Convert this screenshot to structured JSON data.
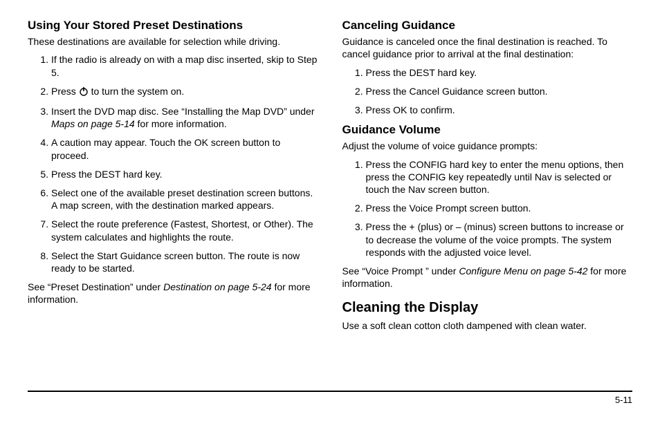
{
  "left": {
    "h1": "Using Your Stored Preset Destinations",
    "intro": "These destinations are available for selection while driving.",
    "steps": {
      "s1": "If the radio is already on with a map disc inserted, skip to Step 5.",
      "s2a": "Press ",
      "s2b": " to turn the system on.",
      "s3a": "Insert the DVD map disc. See “Installing the Map DVD” under ",
      "s3b": "Maps on page 5‑14",
      "s3c": " for more information.",
      "s4": "A caution may appear. Touch the OK screen button to proceed.",
      "s5": "Press the DEST hard key.",
      "s6": "Select one of the available preset destination screen buttons. A map screen, with the destination marked appears.",
      "s7": "Select the route preference (Fastest, Shortest, or Other). The system calculates and highlights the route.",
      "s8": "Select the Start Guidance screen button. The route is now ready to be started."
    },
    "note_a": "See “Preset Destination” under ",
    "note_b": "Destination on page 5‑24",
    "note_c": " for more information."
  },
  "right": {
    "cancel_h": "Canceling Guidance",
    "cancel_intro": "Guidance is canceled once the final destination is reached. To cancel guidance prior to arrival at the final destination:",
    "cancel_steps": {
      "c1": "Press the DEST hard key.",
      "c2": "Press the Cancel Guidance screen button.",
      "c3": "Press OK to confirm."
    },
    "vol_h": "Guidance Volume",
    "vol_intro": "Adjust the volume of voice guidance prompts:",
    "vol_steps": {
      "v1": "Press the CONFIG hard key to enter the menu options, then press the CONFIG key repeatedly until Nav is selected or touch the Nav screen button.",
      "v2": "Press the Voice Prompt screen button.",
      "v3": "Press the + (plus) or – (minus) screen buttons to increase or to decrease the volume of the voice prompts. The system responds with the adjusted voice level."
    },
    "vol_note_a": "See “Voice Prompt ” under ",
    "vol_note_b": "Configure Menu on page 5‑42",
    "vol_note_c": " for more information.",
    "clean_h": "Cleaning the Display",
    "clean_p": "Use a soft clean cotton cloth dampened with clean water."
  },
  "page_number": "5-11"
}
